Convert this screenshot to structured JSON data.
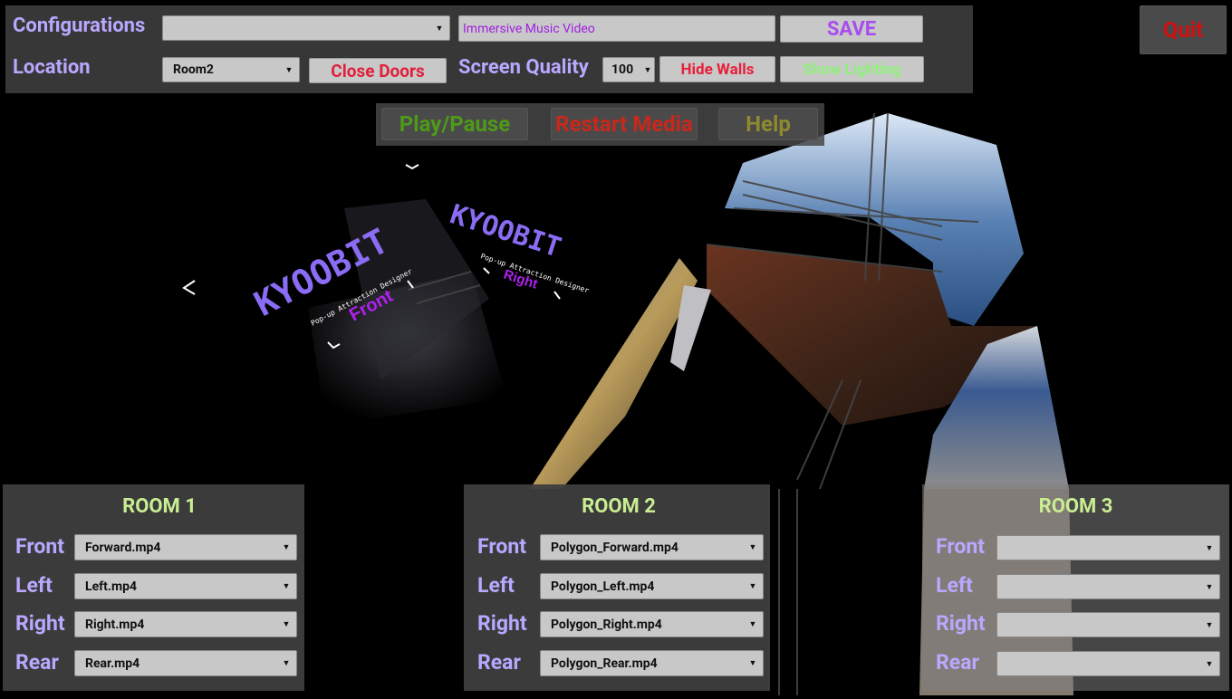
{
  "top": {
    "configurations_label": "Configurations",
    "configurations_value": "",
    "title_input_value": "Immersive Music Video",
    "save_label": "SAVE",
    "location_label": "Location",
    "location_value": "Room2",
    "close_doors_label": "Close Doors",
    "screen_quality_label": "Screen Quality",
    "screen_quality_value": "100",
    "hide_walls_label": "Hide Walls",
    "show_lighting_label": "Show Lighting"
  },
  "quit_label": "Quit",
  "media": {
    "play_pause_label": "Play/Pause",
    "restart_label": "Restart Media",
    "help_label": "Help"
  },
  "scene": {
    "logo_text": "KYOOBIT",
    "tagline": "Pop-up Attraction Designer",
    "wall_front": "Front",
    "wall_right": "Right"
  },
  "rooms": [
    {
      "title": "ROOM 1",
      "front_label": "Front",
      "front": "Forward.mp4",
      "left_label": "Left",
      "left": "Left.mp4",
      "right_label": "Right",
      "right": "Right.mp4",
      "rear_label": "Rear",
      "rear": "Rear.mp4"
    },
    {
      "title": "ROOM 2",
      "front_label": "Front",
      "front": "Polygon_Forward.mp4",
      "left_label": "Left",
      "left": "Polygon_Left.mp4",
      "right_label": "Right",
      "right": "Polygon_Right.mp4",
      "rear_label": "Rear",
      "rear": "Polygon_Rear.mp4"
    },
    {
      "title": "ROOM 3",
      "front_label": "Front",
      "front": "",
      "left_label": "Left",
      "left": "",
      "right_label": "Right",
      "right": "",
      "rear_label": "Rear",
      "rear": ""
    }
  ],
  "colors": {
    "label_purple": "#b9a8ff",
    "save_purple": "#a84cf0",
    "close_doors_red": "#e0203c",
    "hide_walls_red": "#e8203c",
    "show_lighting_green": "#8ff07a",
    "play_green": "#4e9a18",
    "restart_red": "#c8281c",
    "help_olive": "#8e8a2e",
    "quit_red": "#d01010",
    "room_title_green": "#c9ee92",
    "input_text_purple": "#a020e0"
  },
  "icons": [
    "dropdown-arrow-icon"
  ]
}
